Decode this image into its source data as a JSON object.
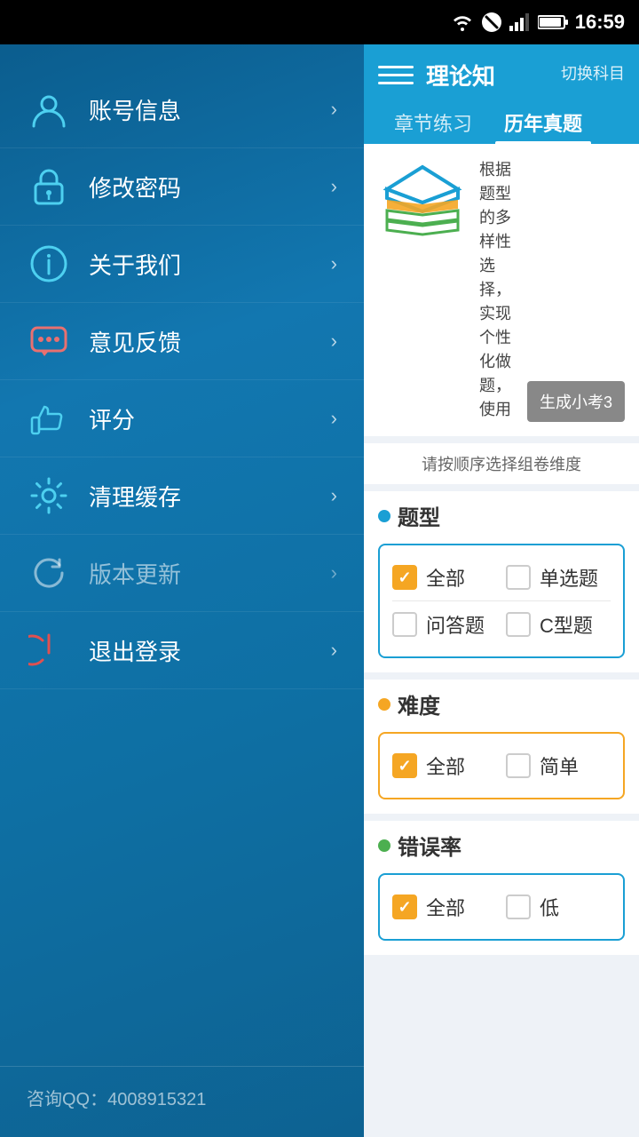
{
  "statusBar": {
    "time": "16:59"
  },
  "sidebar": {
    "items": [
      {
        "id": "account",
        "label": "账号信息",
        "icon": "user"
      },
      {
        "id": "password",
        "label": "修改密码",
        "icon": "lock"
      },
      {
        "id": "about",
        "label": "关于我们",
        "icon": "info"
      },
      {
        "id": "feedback",
        "label": "意见反馈",
        "icon": "chat"
      },
      {
        "id": "rate",
        "label": "评分",
        "icon": "thumb"
      },
      {
        "id": "cache",
        "label": "清理缓存",
        "icon": "gear"
      },
      {
        "id": "update",
        "label": "版本更新",
        "icon": "refresh"
      },
      {
        "id": "logout",
        "label": "退出登录",
        "icon": "power"
      }
    ],
    "footer": "咨询QQ：4008915321"
  },
  "rightPanel": {
    "title": "理论知",
    "subtitle": "切换科目",
    "tabs": [
      {
        "id": "chapter",
        "label": "章节练习",
        "active": false
      },
      {
        "id": "history",
        "label": "历年真题",
        "active": true
      }
    ],
    "banner": {
      "text": "根据题型的多样性选择，实现个性化做题，使用",
      "button": "生成小考3"
    },
    "hint": "请按顺序选择组卷维度",
    "sections": [
      {
        "id": "type",
        "title": "题型",
        "dotColor": "blue",
        "borderColor": "blue",
        "rows": [
          [
            {
              "label": "全部",
              "checked": true
            },
            {
              "label": "单选题",
              "checked": false
            }
          ],
          [
            {
              "label": "问答题",
              "checked": false
            },
            {
              "label": "C型题",
              "checked": false
            }
          ]
        ]
      },
      {
        "id": "difficulty",
        "title": "难度",
        "dotColor": "orange",
        "borderColor": "orange",
        "rows": [
          [
            {
              "label": "全部",
              "checked": true
            },
            {
              "label": "简单",
              "checked": false
            }
          ]
        ]
      },
      {
        "id": "error-rate",
        "title": "错误率",
        "dotColor": "green",
        "borderColor": "blue",
        "rows": [
          [
            {
              "label": "全部",
              "checked": true
            },
            {
              "label": "低",
              "checked": false
            }
          ]
        ]
      }
    ]
  }
}
